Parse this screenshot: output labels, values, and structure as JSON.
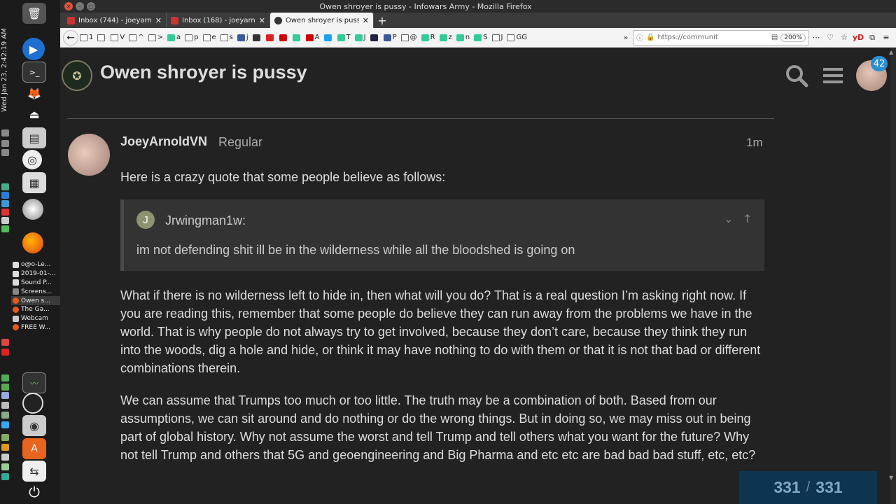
{
  "panel": {
    "clock": "Wed Jan 23, 2:42:19 AM",
    "tasks": [
      "o@o-Le...",
      "2019-01-...",
      "Sound P...",
      "Screens...",
      "Owen s...",
      "The Ga...",
      "Webcam",
      "FREE W..."
    ]
  },
  "window": {
    "title": "Owen shroyer is pussy - Infowars Army - Mozilla Firefox"
  },
  "tabs": [
    {
      "label": "Inbox (744) - joeyarnold",
      "color": "#c33"
    },
    {
      "label": "Inbox (168) - joeyarnold",
      "color": "#c33"
    },
    {
      "label": "Owen shroyer is pussy -",
      "color": "#333"
    }
  ],
  "navbar": {
    "url": "https://communit",
    "zoom": "200%"
  },
  "bookmarks": [
    "1",
    "",
    "V",
    "^",
    ">",
    "a",
    "p",
    "e",
    "s",
    "j",
    "",
    "",
    "",
    "",
    "A",
    "",
    "T",
    "J",
    "",
    "P",
    "@",
    "R",
    "z",
    "n",
    "S",
    "J",
    "GG"
  ],
  "site": {
    "topic_title": "Owen shroyer is pussy",
    "notification_count": "42"
  },
  "post": {
    "username": "JoeyArnoldVN",
    "user_title": "Regular",
    "time": "1m",
    "para1": "Here is a crazy quote that some people believe as follows:",
    "quote": {
      "avatar_letter": "J",
      "user": "Jrwingman1w:",
      "text": "im not defending shit ill be in the wilderness while all the bloodshed is going on"
    },
    "para2": "What if there is no wilderness left to hide in, then what will you do? That is a real question I’m asking right now. If you are reading this, remember that some people do believe they can run away from the problems we have in the world. That is why people do not always try to get involved, because they don’t care, because they think they run into the woods, dig a hole and hide, or think it may have nothing to do with them or that it is not that bad or different combinations therein.",
    "para3": "We can assume that Trumps too much or too little. The truth may be a combination of both. Based from our assumptions, we can sit around and do nothing or do the wrong things. But in doing so, we may miss out in being part of global history. Why not assume the worst and tell Trump and tell others what you want for the future? Why not tell Trump and others that 5G and geoengineering and Big Pharma and etc etc are bad bad bad stuff, etc, etc?"
  },
  "progress": {
    "current": "331",
    "separator": "/",
    "total": "331"
  }
}
